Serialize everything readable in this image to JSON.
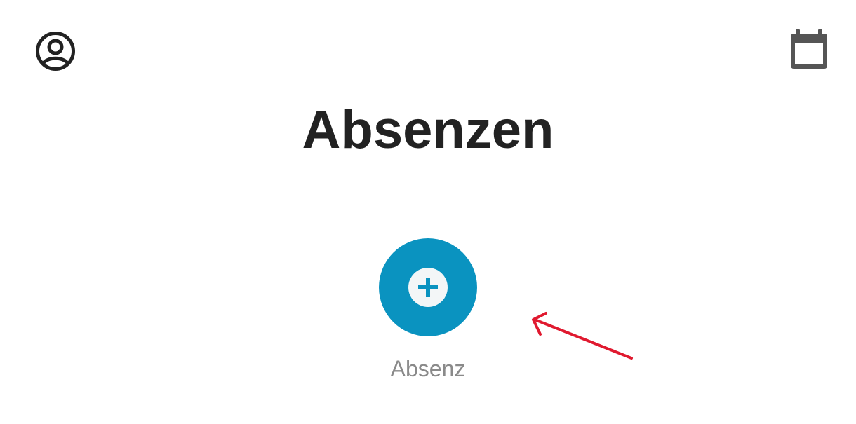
{
  "header": {
    "profile_icon": "account-circle-icon",
    "calendar_icon": "calendar-icon"
  },
  "page": {
    "title": "Absenzen"
  },
  "actions": {
    "add_absence": {
      "icon": "plus-icon",
      "label": "Absenz",
      "color": "#0a93c0"
    }
  },
  "annotation": {
    "arrow_color": "#e0192f"
  }
}
